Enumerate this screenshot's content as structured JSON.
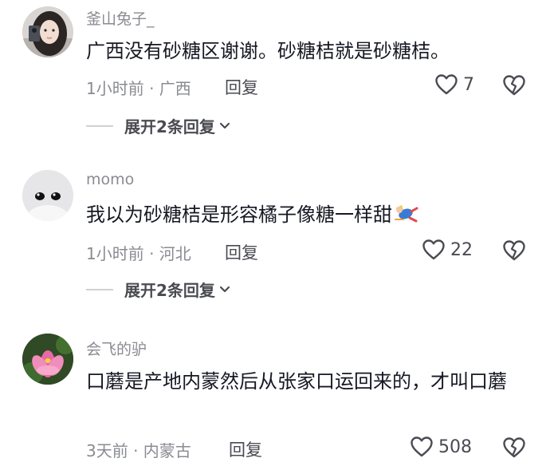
{
  "comments": [
    {
      "username": "釜山兔子_",
      "text": "广西没有砂糖区谢谢。砂糖桔就是砂糖桔。",
      "meta": "1小时前 · 广西",
      "reply_label": "回复",
      "likes": "7",
      "expand_label": "展开2条回复",
      "avatar": "photo-avatar"
    },
    {
      "username": "momo",
      "text": "我以为砂糖桔是形容橘子像糖一样甜",
      "meta": "1小时前 · 河北",
      "reply_label": "回复",
      "likes": "22",
      "expand_label": "展开2条回复",
      "avatar": "cartoon-face-avatar",
      "emoji": "falling-person-sticker"
    },
    {
      "username": "会飞的驴",
      "text": "口蘑是产地内蒙然后从张家口运回来的，才叫口蘑",
      "meta": "3天前 · 内蒙古",
      "reply_label": "回复",
      "likes": "508",
      "avatar": "lotus-flower-avatar"
    }
  ],
  "icons": {
    "like": "heart-outline-icon",
    "dislike": "broken-heart-icon",
    "expand": "chevron-down-icon"
  },
  "colors": {
    "text": "#161823",
    "secondary": "#8a8b91",
    "action": "#4a4b52"
  }
}
